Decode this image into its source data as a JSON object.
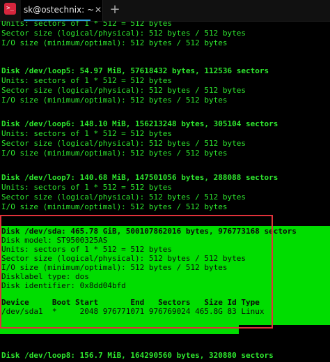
{
  "window": {
    "tab_icon_glyph": ">_",
    "tab_title": "sk@ostechnix: ~",
    "close_glyph": "✕",
    "new_tab_glyph": "+"
  },
  "terminal": {
    "lines": [
      "Units: sectors of 1 * 512 = 512 bytes",
      "Sector size (logical/physical): 512 bytes / 512 bytes",
      "I/O size (minimum/optimal): 512 bytes / 512 bytes",
      "Disk /dev/loop5: 54.97 MiB, 57618432 bytes, 112536 sectors",
      "Units: sectors of 1 * 512 = 512 bytes",
      "Sector size (logical/physical): 512 bytes / 512 bytes",
      "I/O size (minimum/optimal): 512 bytes / 512 bytes",
      "Disk /dev/loop6: 148.10 MiB, 156213248 bytes, 305104 sectors",
      "Units: sectors of 1 * 512 = 512 bytes",
      "Sector size (logical/physical): 512 bytes / 512 bytes",
      "I/O size (minimum/optimal): 512 bytes / 512 bytes",
      "Disk /dev/loop7: 140.68 MiB, 147501056 bytes, 288088 sectors",
      "Units: sectors of 1 * 512 = 512 bytes",
      "Sector size (logical/physical): 512 bytes / 512 bytes",
      "I/O size (minimum/optimal): 512 bytes / 512 bytes",
      "Disk /dev/sda: 465.78 GiB, 500107862016 bytes, 976773168 sectors",
      "Disk model: ST9500325AS",
      "Units: sectors of 1 * 512 = 512 bytes",
      "Sector size (logical/physical): 512 bytes / 512 bytes",
      "I/O size (minimum/optimal): 512 bytes / 512 bytes",
      "Disklabel type: dos",
      "Disk identifier: 0x8dd04bfd",
      "Device     Boot Start       End   Sectors   Size Id Type",
      "/dev/sda1  *     2048 976771071 976769024 465.8G 83 Linux",
      "Disk /dev/loop8: 156.7 MiB, 164290560 bytes, 320880 sectors"
    ]
  },
  "colors": {
    "terminal_text": "#2ee52e",
    "highlight": "#00dd00",
    "selection_border": "#e0323a",
    "tab_accent": "#2fa0e3"
  }
}
